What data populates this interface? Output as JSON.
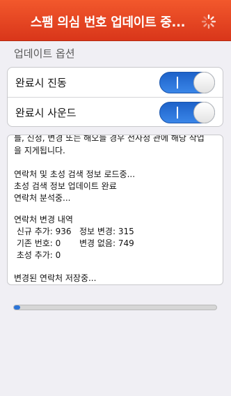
{
  "header": {
    "title": "스팸 의심 번호 업데이트 중..."
  },
  "options": {
    "section_label": "업데이트 옵션",
    "items": [
      {
        "label": "완료시 진동",
        "on": true
      },
      {
        "label": "완료시 사운드",
        "on": true
      }
    ],
    "toggle_mark": "I"
  },
  "log": {
    "lines": [
      "를, 신청, 변경 또는 해오늘 경우 전사청 관에 해당 작업",
      "을 지게됩니다.",
      "",
      "연락처 및 초성 검색 정보 로드중...",
      "초성 검색 정보 업데이트 완료",
      "연락처 분석중...",
      "",
      "연락처 변경 내역",
      " 신규 추가: 936   정보 변경: 315",
      " 기존 번호: 0       변경 없음: 749",
      " 초성 추가: 0",
      "",
      "변경된 연락처 저장중..."
    ]
  },
  "progress": {
    "value_percent": 2
  },
  "colors": {
    "header": "#e3441f",
    "toggle_on": "#2a73dc",
    "background": "#f0eff4"
  },
  "icons": {
    "spinner": "loading-spinner-icon"
  }
}
